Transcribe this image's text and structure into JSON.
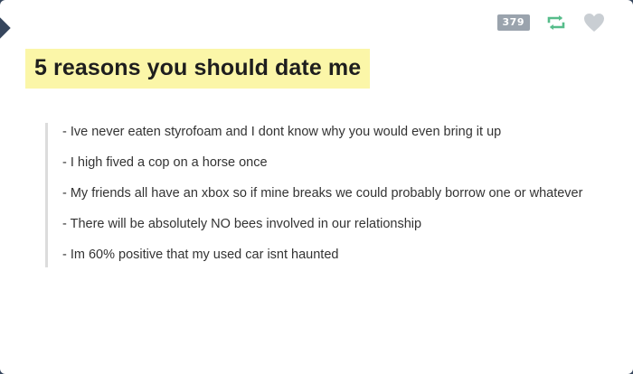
{
  "post": {
    "note_count": "379",
    "title": "5 reasons you should date me",
    "reasons": [
      "- Ive never eaten styrofoam and I dont know why you would even bring it up",
      "- I high fived a cop on a horse once",
      "- My friends all have an xbox so if mine breaks we could probably borrow one or whatever",
      "- There will be absolutely NO bees involved in our relationship",
      "- Im 60% positive that my used car isnt haunted"
    ]
  },
  "icons": {
    "reblog": "reblog-icon",
    "like": "heart-icon"
  },
  "colors": {
    "background": "#36465d",
    "highlight": "#fbf6a8",
    "note_badge": "#9aa3ad",
    "reblog": "#56bc8a",
    "heart": "#c9ced3",
    "quote_border": "#dcdcdc"
  }
}
